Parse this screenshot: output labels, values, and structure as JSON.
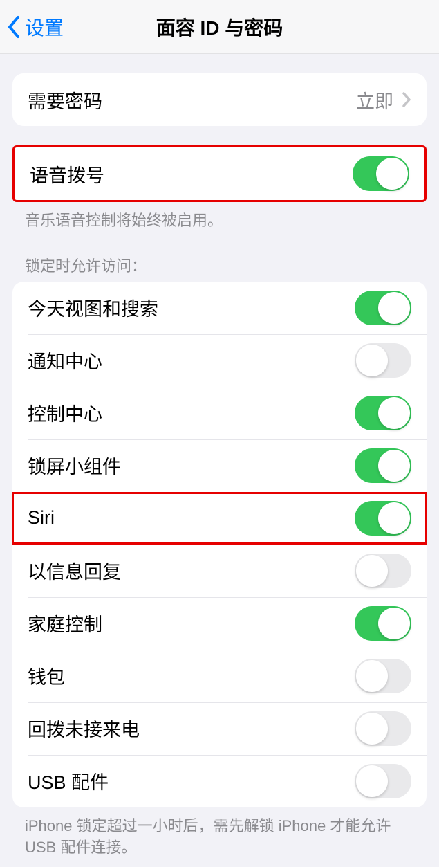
{
  "nav": {
    "back_label": "设置",
    "title": "面容 ID 与密码"
  },
  "require_passcode": {
    "label": "需要密码",
    "value": "立即"
  },
  "voice_dial": {
    "label": "语音拨号",
    "enabled": true
  },
  "voice_dial_footer": "音乐语音控制将始终被启用。",
  "allow_access_header": "锁定时允许访问：",
  "allow_access": [
    {
      "label": "今天视图和搜索",
      "enabled": true
    },
    {
      "label": "通知中心",
      "enabled": false
    },
    {
      "label": "控制中心",
      "enabled": true
    },
    {
      "label": "锁屏小组件",
      "enabled": true
    },
    {
      "label": "Siri",
      "enabled": true,
      "highlighted": true
    },
    {
      "label": "以信息回复",
      "enabled": false
    },
    {
      "label": "家庭控制",
      "enabled": true
    },
    {
      "label": "钱包",
      "enabled": false
    },
    {
      "label": "回拨未接来电",
      "enabled": false
    },
    {
      "label": "USB 配件",
      "enabled": false
    }
  ],
  "usb_footer": "iPhone 锁定超过一小时后，需先解锁 iPhone 才能允许USB 配件连接。"
}
